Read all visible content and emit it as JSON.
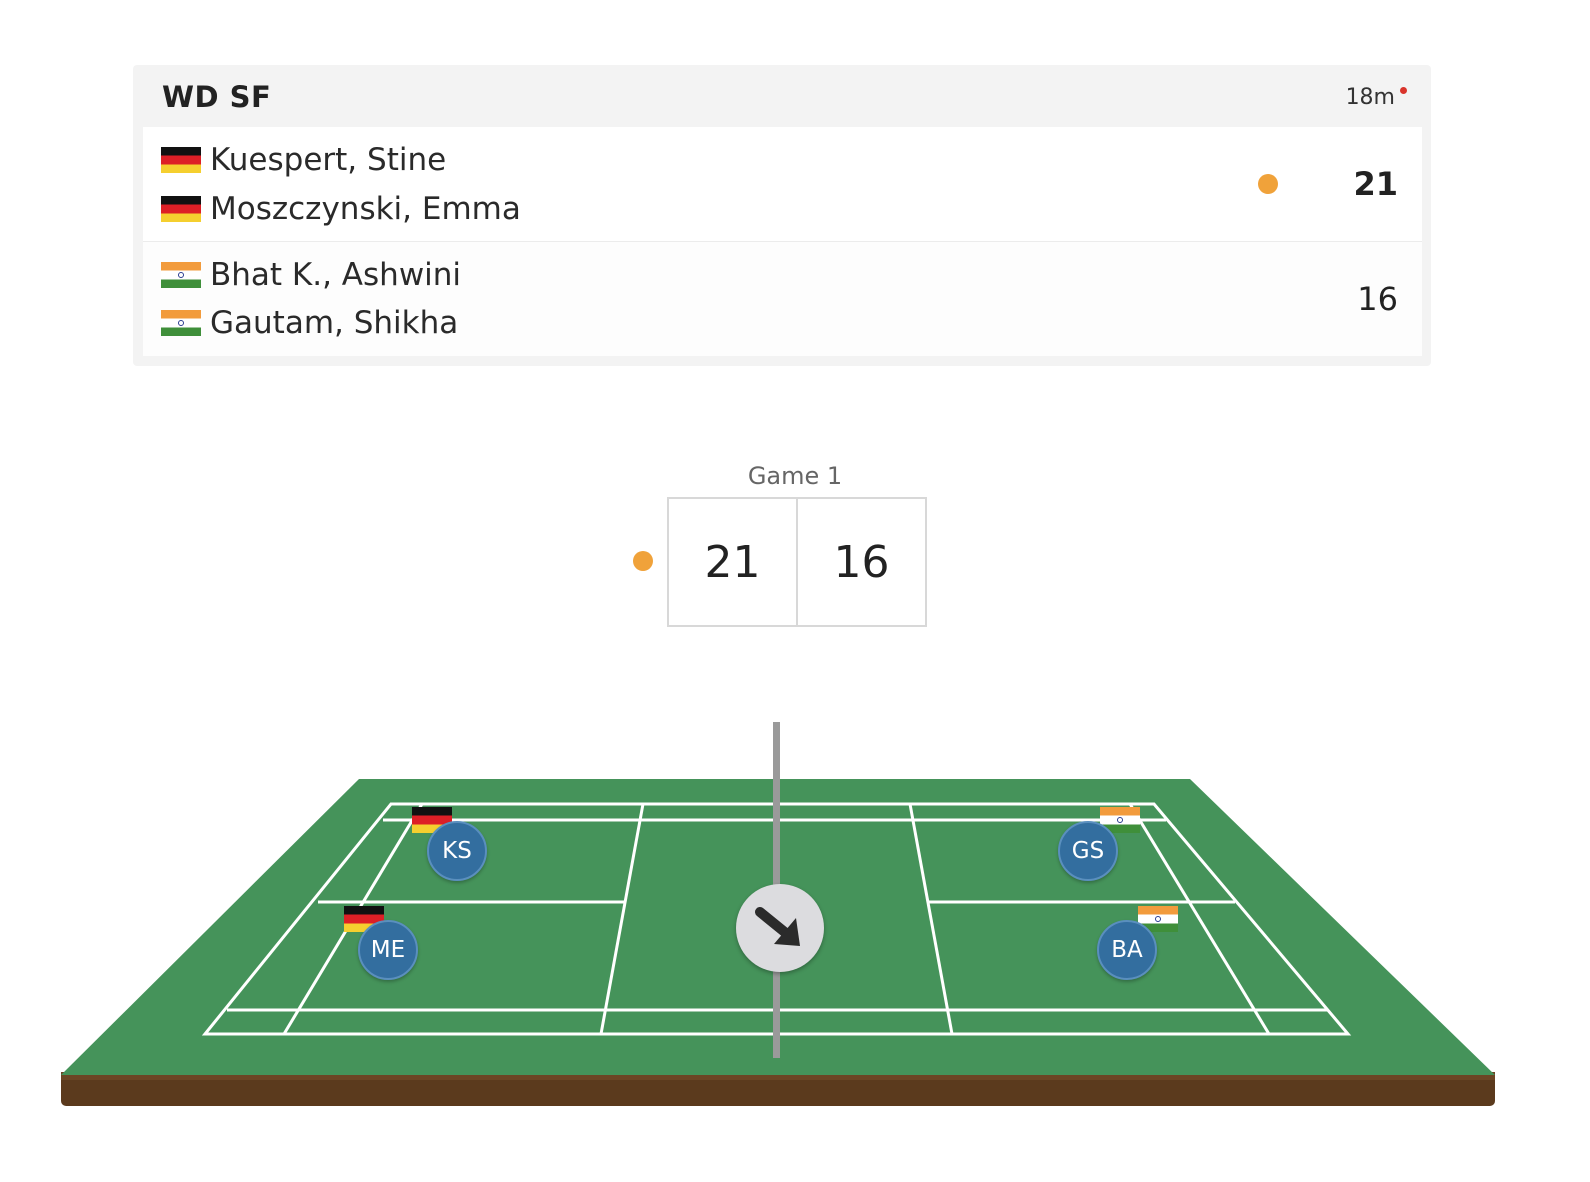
{
  "match": {
    "event": "WD SF",
    "duration": "18m",
    "live_indicator_color": "#d9342b"
  },
  "teams": [
    {
      "players": [
        {
          "name": "Kuespert, Stine",
          "flag": "germany-flag"
        },
        {
          "name": "Moszczynski, Emma",
          "flag": "germany-flag"
        }
      ],
      "score": "21",
      "serving": true,
      "winner": true
    },
    {
      "players": [
        {
          "name": "Bhat K., Ashwini",
          "flag": "india-flag"
        },
        {
          "name": "Gautam, Shikha",
          "flag": "india-flag"
        }
      ],
      "score": "16",
      "serving": false,
      "winner": false
    }
  ],
  "game": {
    "label": "Game 1",
    "scores": [
      "21",
      "16"
    ]
  },
  "court": {
    "players": [
      {
        "initials": "KS",
        "flag": "germany-flag"
      },
      {
        "initials": "ME",
        "flag": "germany-flag"
      },
      {
        "initials": "GS",
        "flag": "india-flag"
      },
      {
        "initials": "BA",
        "flag": "india-flag"
      }
    ],
    "shuttle_direction_icon": "arrow-down-right-icon"
  },
  "colors": {
    "serve_indicator": "#f0a23a",
    "court_green": "#3e8e55",
    "court_base": "#5a3a1e",
    "player_bubble": "#336e9f"
  }
}
